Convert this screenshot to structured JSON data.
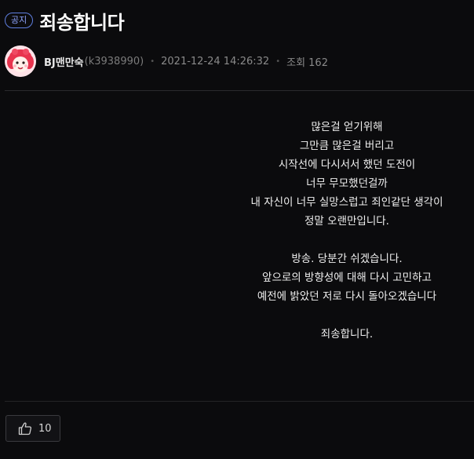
{
  "post": {
    "badge": "공지",
    "title": "죄송합니다",
    "author_name": "BJ맨만숙",
    "author_id": "(k3938990)",
    "datetime": "2021-12-24 14:26:32",
    "views_label": "조회 162"
  },
  "body": {
    "paragraphs": [
      [
        "많은걸 얻기위해",
        "그만큼 많은걸 버리고",
        "시작선에 다시서서 했던 도전이",
        "너무 무모했던걸까",
        "내 자신이 너무 실망스럽고 죄인같단 생각이",
        "정말 오랜만입니다."
      ],
      [
        "방송. 당분간 쉬겠습니다.",
        "앞으로의 방향성에 대해 다시 고민하고",
        "예전에 밝았던 저로 다시 돌아오겠습니다"
      ],
      [
        "죄송합니다."
      ]
    ]
  },
  "like": {
    "count": "10",
    "icon": "thumbs-up-icon"
  },
  "colors": {
    "background": "#0b0b0d",
    "badge": "#5f7fe0",
    "text": "#f0f0f0"
  }
}
